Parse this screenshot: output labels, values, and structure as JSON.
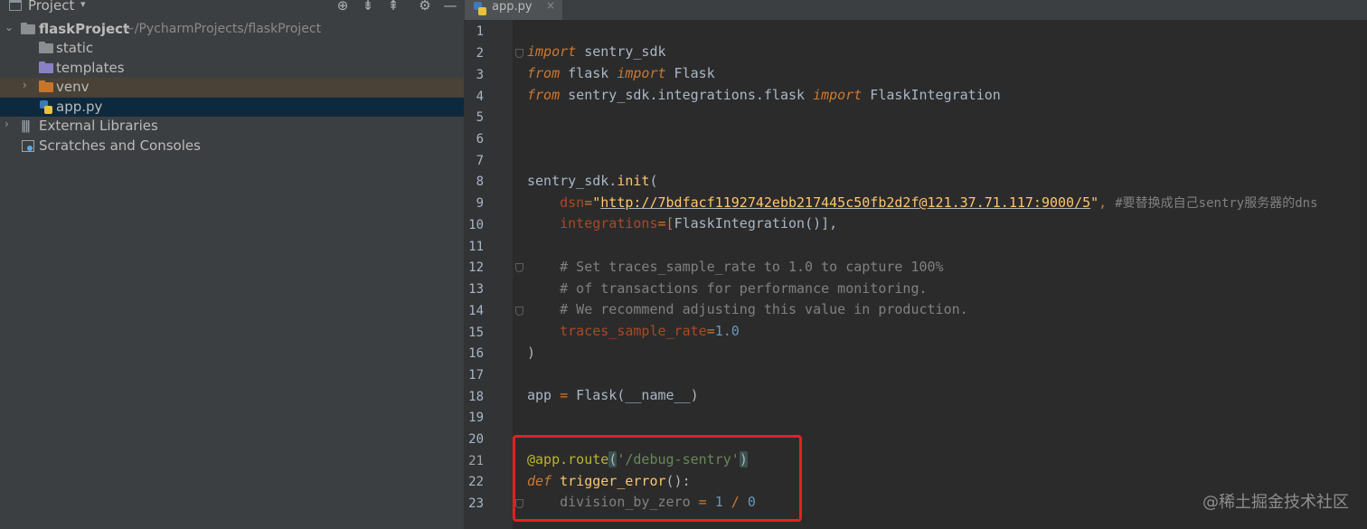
{
  "project_panel": {
    "title": "Project",
    "dropdown_glyph": "▾",
    "toolbar_icons": [
      "target-icon",
      "expand-icon",
      "collapse-icon",
      "gear-icon",
      "minimize-icon"
    ],
    "root": {
      "name": "flaskProject",
      "path": "~/PycharmProjects/flaskProject"
    },
    "items": [
      {
        "label": "static",
        "icon": "folder-icon"
      },
      {
        "label": "templates",
        "icon": "folder-icon"
      },
      {
        "label": "venv",
        "icon": "folder-icon"
      },
      {
        "label": "app.py",
        "icon": "python-file-icon"
      },
      {
        "label": "External Libraries",
        "icon": "library-icon"
      },
      {
        "label": "Scratches and Consoles",
        "icon": "scratches-icon"
      }
    ]
  },
  "editor": {
    "tab": {
      "label": "app.py",
      "close_glyph": "×"
    },
    "line_numbers": [
      "1",
      "2",
      "3",
      "4",
      "5",
      "6",
      "7",
      "8",
      "9",
      "10",
      "11",
      "12",
      "13",
      "14",
      "15",
      "16",
      "17",
      "18",
      "19",
      "20",
      "21",
      "22",
      "23"
    ],
    "code": {
      "l2_kw": "import",
      "l2_rest": " sentry_sdk",
      "l3_kw1": "from",
      "l3_mod": " flask ",
      "l3_kw2": "import",
      "l3_rest": " Flask",
      "l4_kw1": "from",
      "l4_mod": " sentry_sdk.integrations.flask ",
      "l4_kw2": "import",
      "l4_rest": " FlaskIntegration",
      "l8_a": "sentry_sdk.",
      "l8_fn": "init",
      "l8_b": "(",
      "l9_indent": "    ",
      "l9_param": "dsn",
      "l9_eq": "=",
      "l9_q1": "\"",
      "l9_url": "http://7bdfacf1192742ebb217445c50fb2d2f@121.37.71.117:9000/5",
      "l9_q2": "\"",
      "l9_comma": ", ",
      "l9_cmt": "#要替换成自己sentry服务器的dns",
      "l10_indent": "    ",
      "l10_param": "integrations",
      "l10_eq": "=[",
      "l10_cls": "FlaskIntegration",
      "l10_end": "()],",
      "l12": "    # Set traces_sample_rate to 1.0 to capture 100%",
      "l13": "    # of transactions for performance monitoring.",
      "l14": "    # We recommend adjusting this value in production.",
      "l15_indent": "    ",
      "l15_param": "traces_sample_rate",
      "l15_eq": "=",
      "l15_num": "1.0",
      "l16": ")",
      "l18_a": "app ",
      "l18_eq": "=",
      "l18_fn": " Flask",
      "l18_b": "(__name__)",
      "l21_deco": "@app.route",
      "l21_p1": "(",
      "l21_str": "'/debug-sentry'",
      "l21_p2": ")",
      "l22_kw": "def",
      "l22_fn": " trigger_error",
      "l22_rest": "():",
      "l23_indent": "    ",
      "l23_name": "division_by_zero ",
      "l23_eq": "=",
      "l23_n1": " 1 ",
      "l23_op": "/",
      "l23_n2": " 0"
    }
  },
  "watermark": "@稀土掘金技术社区",
  "colors": {
    "highlight_box": "#e42020",
    "keyword": "#cc7832",
    "function": "#ffc66d",
    "comment": "#808080",
    "number": "#6897bb"
  }
}
